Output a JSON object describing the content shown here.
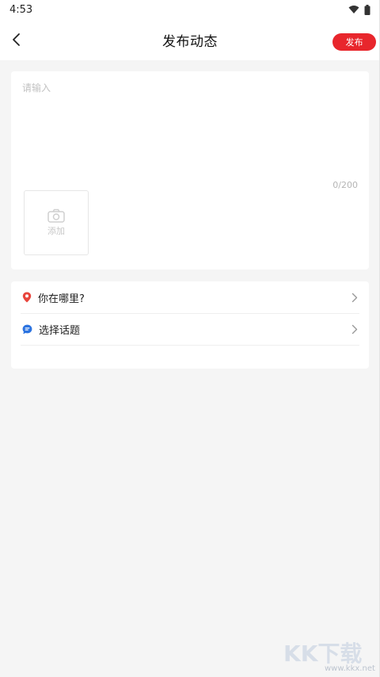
{
  "status_bar": {
    "time": "4:53"
  },
  "nav": {
    "title": "发布动态",
    "publish_label": "发布"
  },
  "compose": {
    "placeholder": "请输入",
    "value": "",
    "char_count": "0/200",
    "add_label": "添加"
  },
  "options": [
    {
      "label": "你在哪里?",
      "icon": "location-pin-icon",
      "color": "#e8453c"
    },
    {
      "label": "选择话题",
      "icon": "chat-bubble-icon",
      "color": "#2b73e0"
    }
  ],
  "colors": {
    "accent": "#e8262c",
    "background": "#f5f5f5"
  },
  "watermark": {
    "brand": "KK下载",
    "url": "www.kkx.net"
  }
}
